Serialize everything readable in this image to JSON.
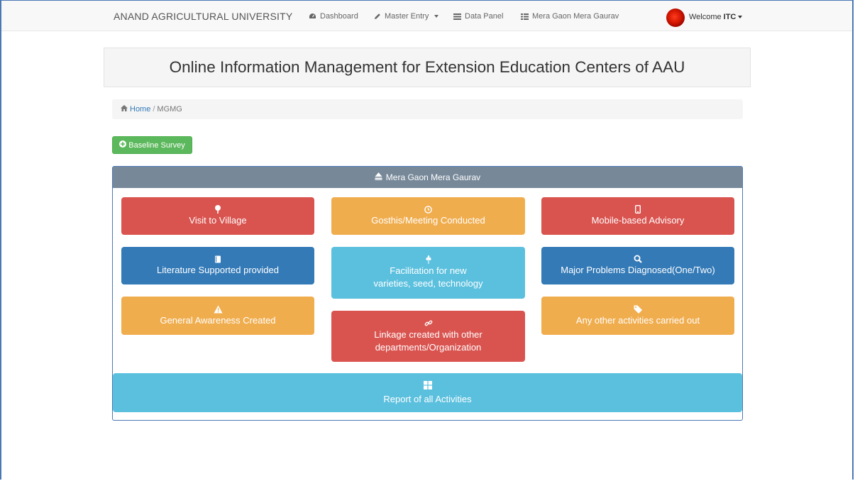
{
  "navbar": {
    "brand": "ANAND AGRICULTURAL UNIVERSITY",
    "items": [
      {
        "label": "Dashboard",
        "icon": "dashboard-icon"
      },
      {
        "label": "Master Entry",
        "icon": "pencil-icon"
      },
      {
        "label": "Data Panel",
        "icon": "list-icon"
      },
      {
        "label": "Mera Gaon Mera Gaurav",
        "icon": "th-list-icon"
      }
    ],
    "welcome_prefix": "Welcome",
    "welcome_user": "ITC"
  },
  "hero": {
    "title": "Online Information Management for Extension Education Centers of AAU"
  },
  "breadcrumb": {
    "home": "Home",
    "separator": "/",
    "current": "MGMG"
  },
  "actions": {
    "baseline_survey": "Baseline Survey"
  },
  "panel": {
    "heading": "Mera Gaon Mera Gaurav",
    "tiles": [
      {
        "label": "Visit to Village",
        "color": "#d9534f",
        "icon": "tree-icon"
      },
      {
        "label": "Gosthis/Meeting Conducted",
        "color": "#f0ad4e",
        "icon": "clock-icon"
      },
      {
        "label": "Mobile-based Advisory",
        "color": "#d9534f",
        "icon": "mobile-icon"
      },
      {
        "label": "Literature Supported provided",
        "color": "#337ab7",
        "icon": "book-icon"
      },
      {
        "label1": "Facilitation for new",
        "label2": "varieties, seed, technology",
        "color": "#5bc0de",
        "icon": "grain-icon"
      },
      {
        "label": "Major Problems Diagnosed(One/Two)",
        "color": "#337ab7",
        "icon": "search-icon"
      },
      {
        "label": "General Awareness Created",
        "color": "#f0ad4e",
        "icon": "warning-icon"
      },
      {
        "label1": "Linkage created with other",
        "label2": "departments/Organization",
        "color": "#d9534f",
        "icon": "link-icon"
      },
      {
        "label": "Any other activities carried out",
        "color": "#f0ad4e",
        "icon": "tags-icon"
      }
    ],
    "report": {
      "label": "Report of all Activities",
      "icon": "grid-icon"
    }
  }
}
